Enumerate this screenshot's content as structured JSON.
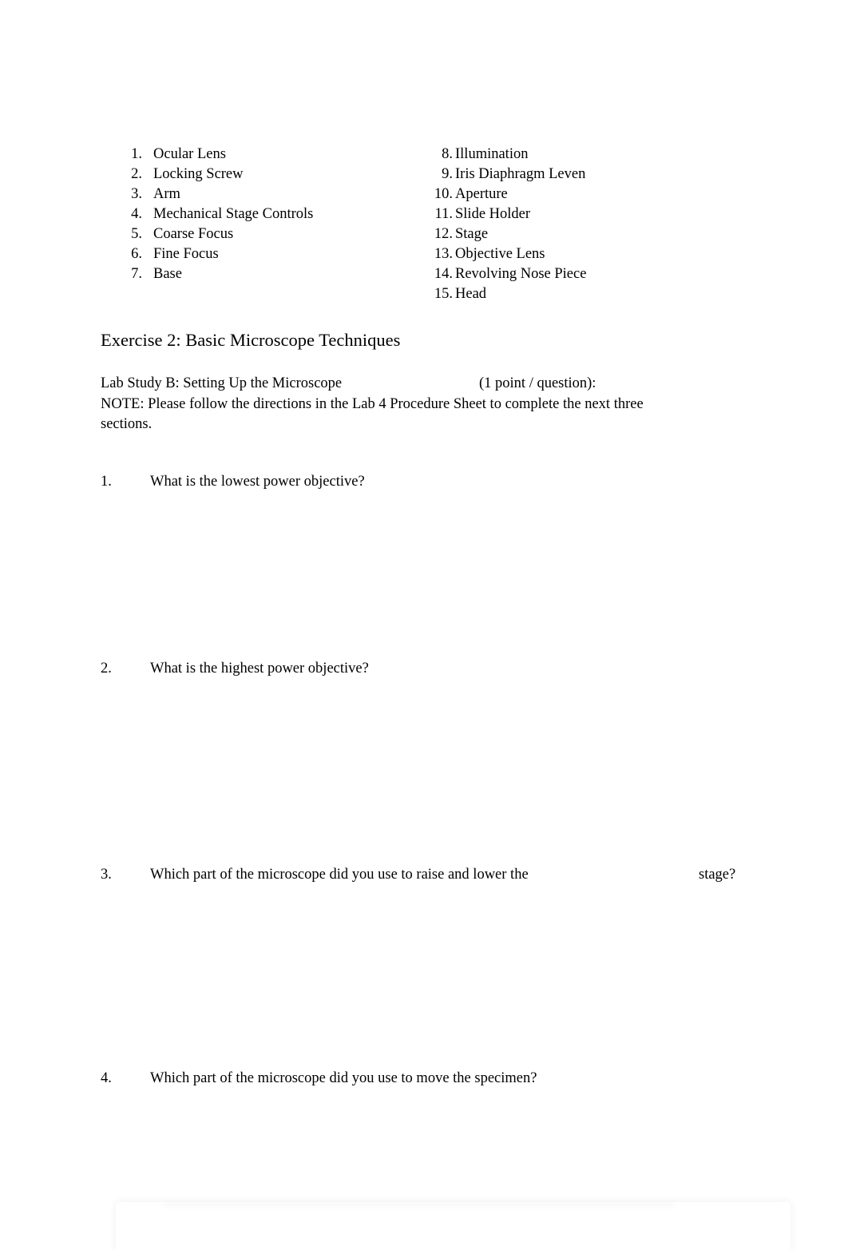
{
  "document": {
    "parts_list": {
      "left_column": [
        {
          "number": "1.",
          "label": "Ocular Lens"
        },
        {
          "number": "2.",
          "label": "Locking Screw"
        },
        {
          "number": "3.",
          "label": "Arm"
        },
        {
          "number": "4.",
          "label": "Mechanical Stage Controls"
        },
        {
          "number": "5.",
          "label": "Coarse Focus"
        },
        {
          "number": "6.",
          "label": "Fine Focus"
        },
        {
          "number": "7.",
          "label": "Base"
        }
      ],
      "right_column": [
        {
          "number": "8.",
          "label": "Illumination"
        },
        {
          "number": "9.",
          "label": "Iris Diaphragm Leven"
        },
        {
          "number": "10.",
          "label": "Aperture"
        },
        {
          "number": "11.",
          "label": "Slide Holder"
        },
        {
          "number": "12.",
          "label": "Stage"
        },
        {
          "number": "13.",
          "label": "Objective Lens"
        },
        {
          "number": "14.",
          "label": "Revolving Nose Piece"
        },
        {
          "number": "15.",
          "label": "Head"
        }
      ]
    },
    "section_heading": "Exercise 2: Basic Microscope Techniques",
    "lab_study": {
      "title": "Lab Study B: Setting Up the Microscope",
      "points": "(1 point / question):",
      "note": "NOTE: Please follow the directions in the Lab 4 Procedure Sheet to complete the next three sections."
    },
    "questions": [
      {
        "number": "1.",
        "text": "What is the lowest power objective?",
        "tail": ""
      },
      {
        "number": "2.",
        "text": "What is the highest power objective?",
        "tail": ""
      },
      {
        "number": "3.",
        "text": "Which part of the microscope did you use to raise and lower the",
        "tail": "stage?"
      },
      {
        "number": "4.",
        "text": "Which part of the microscope did you use to move the specimen?",
        "tail": ""
      }
    ]
  }
}
